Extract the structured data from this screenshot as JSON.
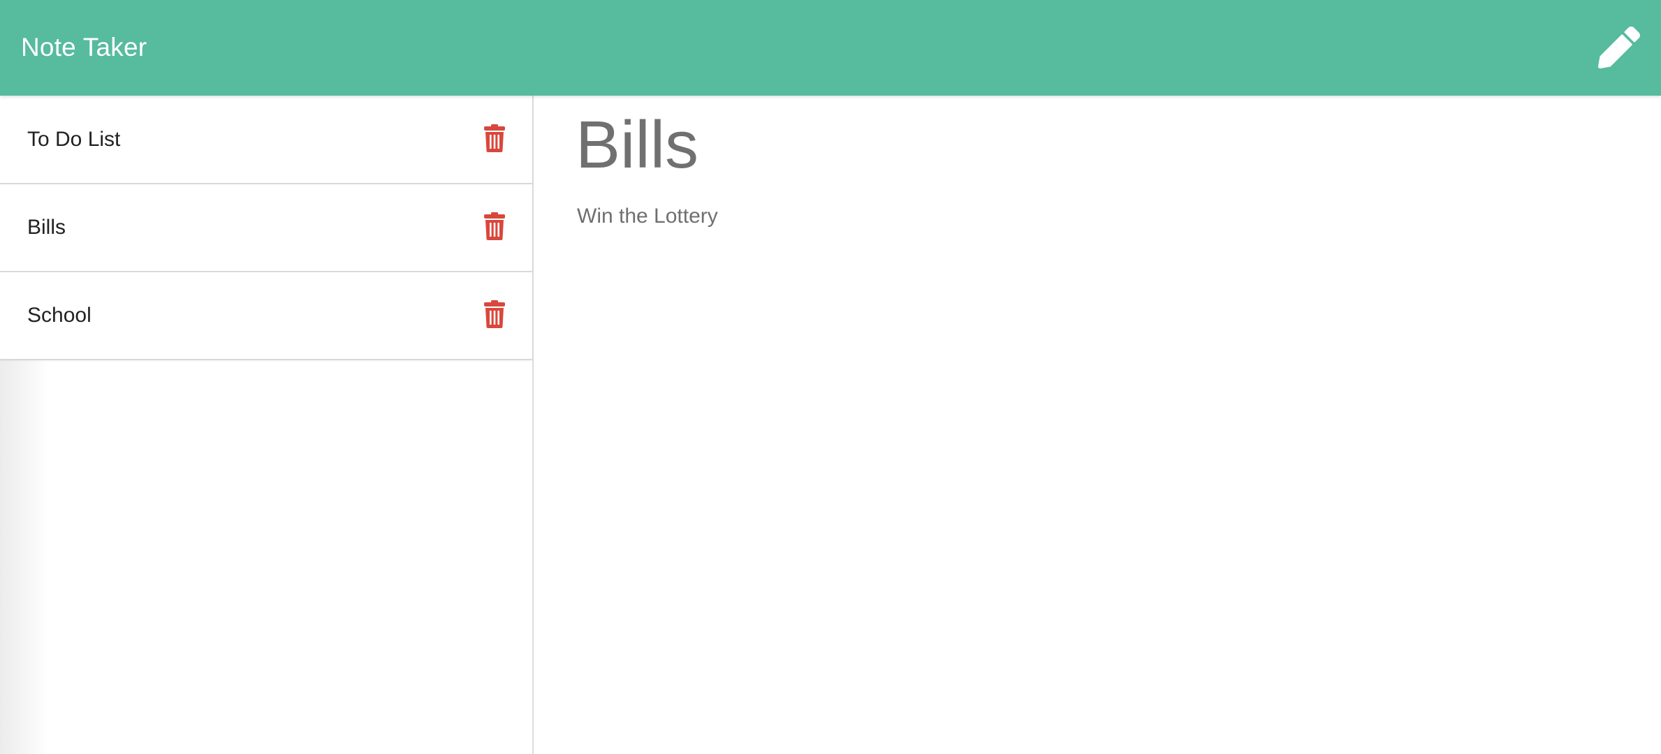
{
  "navbar": {
    "brand": "Note Taker",
    "new_note_icon": "pencil-icon",
    "background_color": "#57bb9e"
  },
  "notes": [
    {
      "title": "To Do List",
      "delete_icon": "trash-icon"
    },
    {
      "title": "Bills",
      "delete_icon": "trash-icon"
    },
    {
      "title": "School",
      "delete_icon": "trash-icon"
    }
  ],
  "active_note": {
    "title": "Bills",
    "text": "Win the Lottery"
  },
  "colors": {
    "accent": "#57bb9e",
    "delete": "#d9473c",
    "text_muted": "#707070"
  }
}
